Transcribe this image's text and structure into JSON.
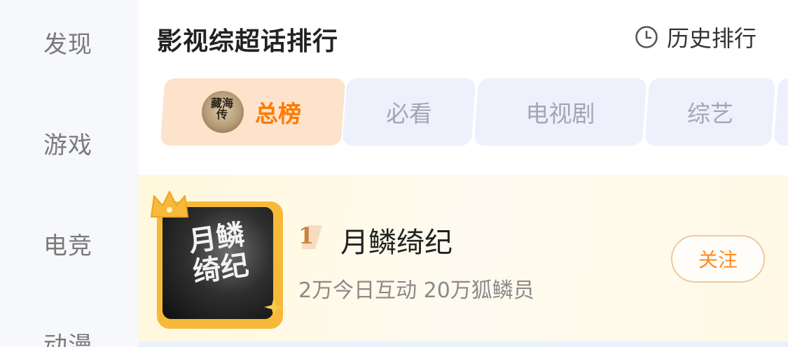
{
  "sidebar": {
    "items": [
      {
        "label": "发现"
      },
      {
        "label": "游戏"
      },
      {
        "label": "电竞"
      },
      {
        "label": "动漫"
      }
    ]
  },
  "header": {
    "title": "影视综超话排行",
    "history_label": "历史排行",
    "history_icon": "clock-icon"
  },
  "tabs": [
    {
      "label": "总榜",
      "selected": true,
      "avatar_text": "藏海传"
    },
    {
      "label": "必看"
    },
    {
      "label": "电视剧"
    },
    {
      "label": "综艺"
    }
  ],
  "ranking": [
    {
      "rank": "1",
      "name": "月鳞绮纪",
      "stats": "2万今日互动 20万狐鳞员",
      "follow_label": "关注",
      "cover_text": "月鳞绮纪"
    }
  ],
  "colors": {
    "accent": "#ff7a00",
    "selected_tab_bg": "#fde3cc",
    "tab_bg": "#eef0fb",
    "cover_frame": "#f6b93a"
  }
}
